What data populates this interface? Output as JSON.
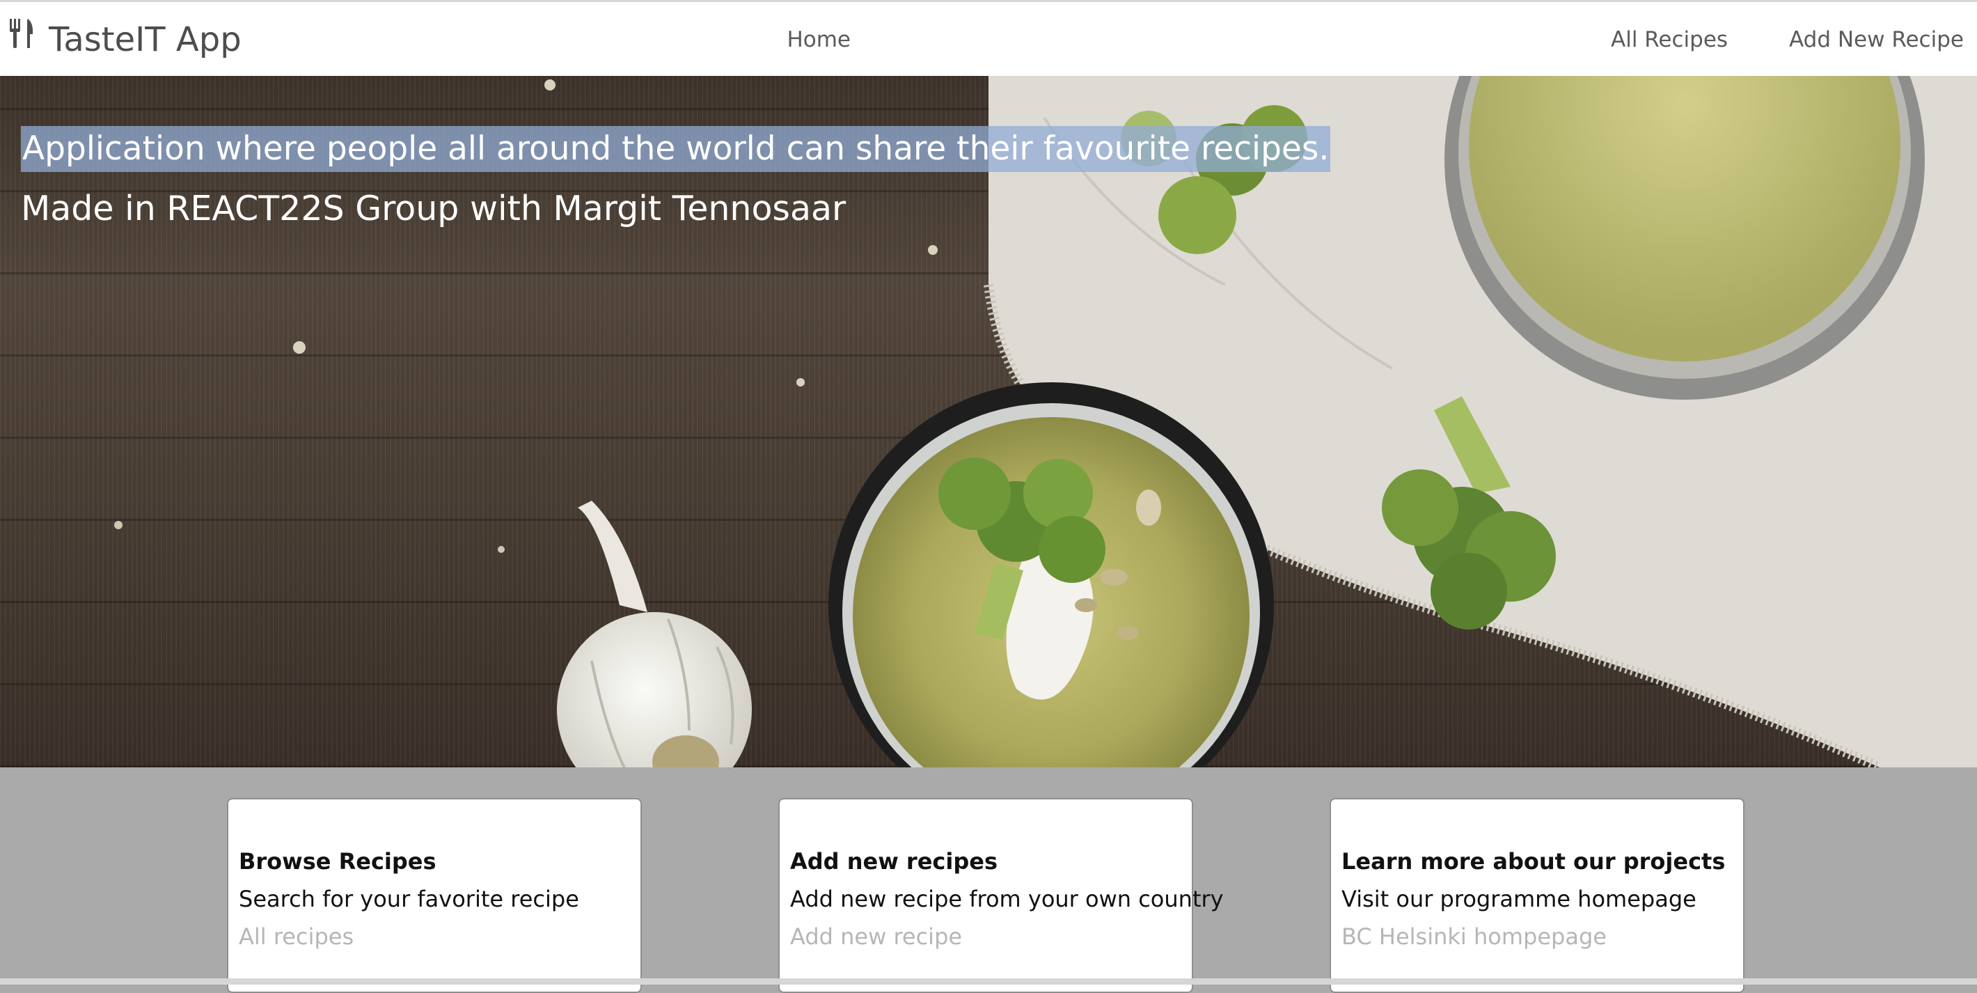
{
  "navbar": {
    "brand": "TasteIT App",
    "brand_icon": "fork-knife-icon",
    "links": [
      "Home",
      "All Recipes",
      "Add New Recipe"
    ]
  },
  "hero": {
    "headline": "Application where people all around the world can share their favourite recipes.",
    "subline": "Made in REACT22S Group with Margit Tennosaar"
  },
  "cards": [
    {
      "title": "Browse Recipes",
      "text": "Search for your favorite recipe",
      "link": "All recipes"
    },
    {
      "title": "Add new recipes",
      "text": "Add new recipe from your own country",
      "link": "Add new recipe"
    },
    {
      "title": "Learn more about our projects",
      "text": "Visit our programme homepage",
      "link": "BC Helsinki hompepage"
    }
  ],
  "colors": {
    "navbar_bg": "#ffffff",
    "page_bg": "#aaaaab",
    "highlight": "#92acd6",
    "link_muted": "#b6b6b6"
  }
}
